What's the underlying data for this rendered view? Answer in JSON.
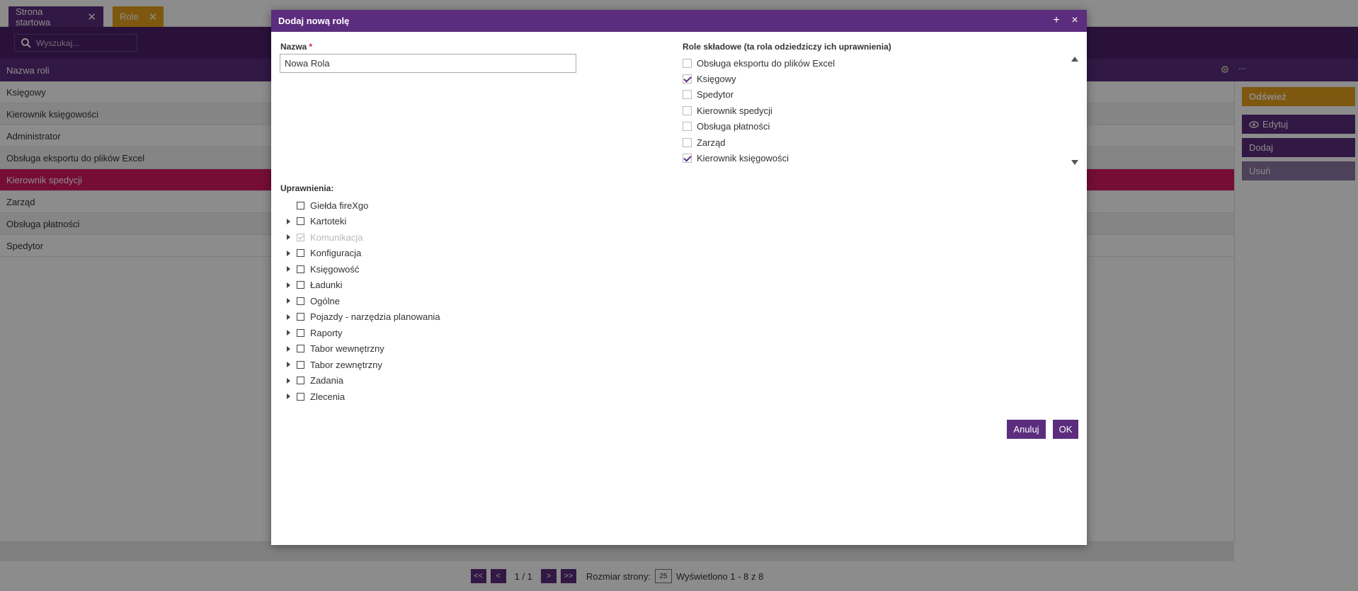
{
  "tabs": [
    {
      "label": "Strona startowa"
    },
    {
      "label": "Role"
    }
  ],
  "search": {
    "placeholder": "Wyszukaj..."
  },
  "grid": {
    "column_header": "Nazwa roli",
    "header_ext": "...",
    "rows": [
      {
        "name": "Księgowy"
      },
      {
        "name": "Kierownik księgowości"
      },
      {
        "name": "Administrator"
      },
      {
        "name": "Obsługa eksportu do plików Excel"
      },
      {
        "name": "Kierownik spedycji"
      },
      {
        "name": "Zarząd"
      },
      {
        "name": "Obsługa płatności"
      },
      {
        "name": "Spedytor"
      }
    ]
  },
  "side": {
    "refresh": "Odśwież",
    "edit": "Edytuj",
    "add": "Dodaj",
    "delete": "Usuń"
  },
  "pager": {
    "first": "<<",
    "prev": "<",
    "next": ">",
    "last": ">>",
    "page": "1 / 1",
    "size_label": "Rozmiar strony:",
    "size": "25",
    "shown": "Wyświetlono 1 - 8 z 8"
  },
  "modal": {
    "title": "Dodaj nową rolę",
    "name_label": "Nazwa",
    "required_mark": "*",
    "name_value": "Nowa Rola",
    "roles_label": "Role składowe (ta rola odziedziczy ich uprawnienia)",
    "roles": [
      {
        "label": "Obsługa eksportu do plików Excel",
        "checked": false
      },
      {
        "label": "Księgowy",
        "checked": true
      },
      {
        "label": "Spedytor",
        "checked": false
      },
      {
        "label": "Kierownik spedycji",
        "checked": false
      },
      {
        "label": "Obsługa płatności",
        "checked": false
      },
      {
        "label": "Zarząd",
        "checked": false
      },
      {
        "label": "Kierownik księgowości",
        "checked": true
      }
    ],
    "perms_label": "Uprawnienia:",
    "perms": [
      {
        "label": "Giełda fireXgo",
        "expandable": false,
        "disabled": false
      },
      {
        "label": "Kartoteki",
        "expandable": true,
        "disabled": false
      },
      {
        "label": "Komunikacja",
        "expandable": true,
        "disabled": true
      },
      {
        "label": "Konfiguracja",
        "expandable": true,
        "disabled": false
      },
      {
        "label": "Księgowość",
        "expandable": true,
        "disabled": false
      },
      {
        "label": "Ładunki",
        "expandable": true,
        "disabled": false
      },
      {
        "label": "Ogólne",
        "expandable": true,
        "disabled": false
      },
      {
        "label": "Pojazdy - narzędzia planowania",
        "expandable": true,
        "disabled": false
      },
      {
        "label": "Raporty",
        "expandable": true,
        "disabled": false
      },
      {
        "label": "Tabor wewnętrzny",
        "expandable": true,
        "disabled": false
      },
      {
        "label": "Tabor zewnętrzny",
        "expandable": true,
        "disabled": false
      },
      {
        "label": "Zadania",
        "expandable": true,
        "disabled": false
      },
      {
        "label": "Zlecenia",
        "expandable": true,
        "disabled": false
      }
    ],
    "cancel": "Anuluj",
    "ok": "OK",
    "plus_symbol": "+",
    "close_symbol": "×"
  },
  "colors": {
    "primary": "#5c2d7e",
    "accent": "#e6a01a",
    "selected": "#d81b60"
  }
}
